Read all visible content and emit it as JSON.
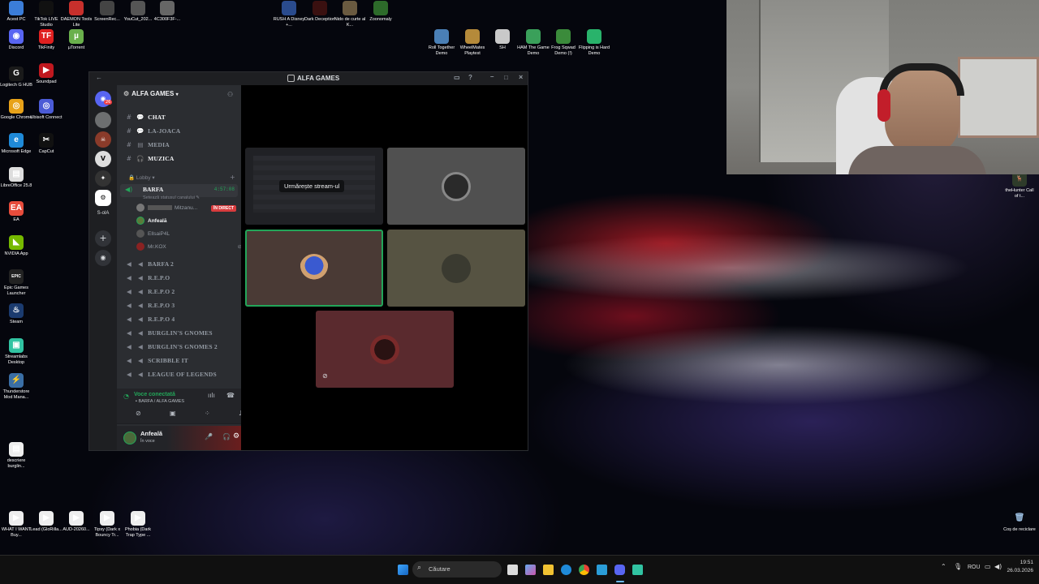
{
  "desktop": {
    "top_icons": [
      {
        "label": "Acest PC",
        "color": "#3b7dd8"
      },
      {
        "label": "TikTok LIVE Studio",
        "color": "#111111"
      },
      {
        "label": "DAEMON Tools Lite",
        "color": "#c8302c"
      },
      {
        "label": "ScreenRec...",
        "color": "#444444"
      },
      {
        "label": "YouCut_202...",
        "color": "#555555"
      },
      {
        "label": "4C300F3F-...",
        "color": "#666666"
      },
      {
        "label": "RUSH A Disney +...",
        "color": "#2a4b8d"
      },
      {
        "label": "Dark Deception",
        "color": "#3a1010"
      },
      {
        "label": "Nido de curte al K...",
        "color": "#6a5a40"
      },
      {
        "label": "Zoonomaly",
        "color": "#2d6b2a"
      }
    ],
    "left_icons": [
      {
        "label": "Discord",
        "color": "#5865f2",
        "glyph": "◉"
      },
      {
        "label": "TikFinity",
        "color": "#e02020",
        "glyph": "TF"
      },
      {
        "label": "µTorrent",
        "color": "#6ab04c",
        "glyph": "µ"
      },
      {
        "label": "Logitech G HUB",
        "color": "#1a1a1a",
        "glyph": "G"
      },
      {
        "label": "Soundpad",
        "color": "#c0181f",
        "glyph": "▶"
      },
      {
        "label": "Google Chrome",
        "color": "#e8a219",
        "glyph": "◎"
      },
      {
        "label": "Ubisoft Connect",
        "color": "#4b5bd6",
        "glyph": "◎"
      },
      {
        "label": "Microsoft Edge",
        "color": "#1f8ad8",
        "glyph": "e"
      },
      {
        "label": "CapCut",
        "color": "#111111",
        "glyph": "✂"
      },
      {
        "label": "LibreOffice 25.8",
        "color": "#dddddd",
        "glyph": "▤"
      },
      {
        "label": "EA",
        "color": "#e74c3c",
        "glyph": "EA"
      },
      {
        "label": "NVIDIA App",
        "color": "#76b900",
        "glyph": "◣"
      },
      {
        "label": "Epic Games Launcher",
        "color": "#222222",
        "glyph": "EPIC"
      },
      {
        "label": "Steam",
        "color": "#1b3b6f",
        "glyph": "♨"
      },
      {
        "label": "Streamlabs Desktop",
        "color": "#31c3a2",
        "glyph": "▣"
      },
      {
        "label": "Thunderstore Mod Mana...",
        "color": "#3a6ea5",
        "glyph": "⚡"
      },
      {
        "label": "descriere burglin...",
        "color": "#eeeeee",
        "glyph": "▤"
      }
    ],
    "bottom_icons": [
      {
        "label": "WHAT I WANT Buy..."
      },
      {
        "label": "Lead (GloRilla..."
      },
      {
        "label": "AUD-20260..."
      },
      {
        "label": "Tipsy (Dark x Bouncy Tr..."
      },
      {
        "label": "Phobia (Dark Trap Type ..."
      }
    ],
    "game_icons": [
      {
        "label": "Roll Together Demo",
        "color": "#4a7fb5"
      },
      {
        "label": "WheelMates Playtest",
        "color": "#b58a3a"
      },
      {
        "label": "SH",
        "color": "#c9c9c9"
      },
      {
        "label": "HAM The Game Demo",
        "color": "#3aa05a"
      },
      {
        "label": "Frog Sqwad Demo (!)",
        "color": "#3b8b3b"
      },
      {
        "label": "Flipping is Hard Demo",
        "color": "#29b36b"
      }
    ],
    "right_icons": [
      {
        "label": "theHunter Call of t..."
      },
      {
        "label": "Coș de reciclare"
      }
    ]
  },
  "discord": {
    "window_title": "ALFA GAMES",
    "server_name": "ALFA GAMES",
    "server_sidebar": {
      "badge": "26",
      "label": "S-olA"
    },
    "text_channels": [
      "CHAT",
      "LA-JOACA",
      "MEDIA",
      "MUZICA"
    ],
    "category": "Lobby",
    "active_voice": {
      "name": "BARFA",
      "timer": "4:57:08",
      "status": "Setează statusul canalului",
      "members": [
        {
          "name": "Mitzanu...",
          "badge": "ÎN DIRECT",
          "color": "#777777"
        },
        {
          "name": "Anfeală",
          "color": "#5a7a3a"
        },
        {
          "name": "EllsaiP4L",
          "color": "#555555"
        },
        {
          "name": "Mr.KOX",
          "color": "#8a2222"
        }
      ]
    },
    "voice_channels": [
      "BARFA 2",
      "R.E.P.O",
      "R.E.P.O 2",
      "R.E.P.O 3",
      "R.E.P.O 4",
      "BURGLIN'S GNOMES",
      "BURGLIN'S GNOMES 2",
      "SCRIBBLE IT",
      "LEAGUE OF LEGENDS"
    ],
    "voice_panel": {
      "status": "Voce conectată",
      "location": "BARFA / ALFA GAMES"
    },
    "user_panel": {
      "name": "Anfeală",
      "status": "În voce"
    },
    "stage": {
      "stream_button": "Urmărește stream-ul"
    }
  },
  "taskbar": {
    "search_placeholder": "Căutare",
    "language": "ROU",
    "time": "19:51",
    "date": "26.03.2026"
  }
}
